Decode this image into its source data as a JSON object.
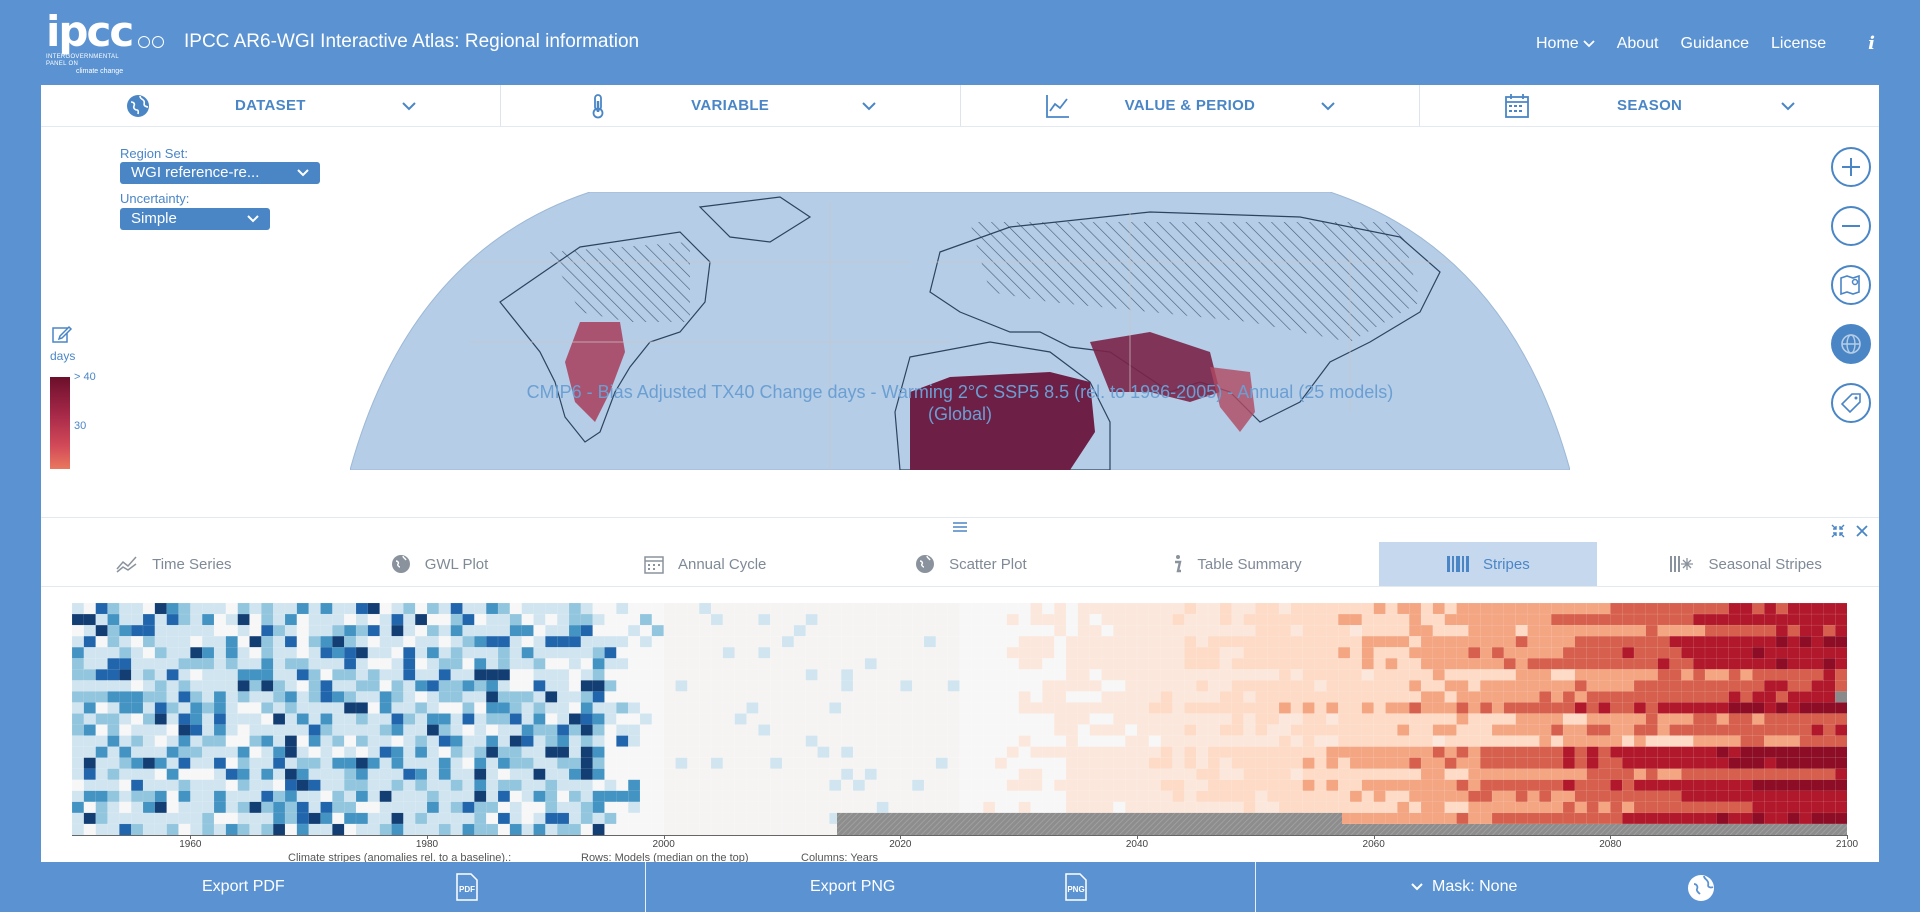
{
  "header": {
    "logo_text": "ipcc",
    "logo_subtitle": "INTERGOVERNMENTAL PANEL ON",
    "logo_subtitle2": "climate change",
    "title": "IPCC AR6-WGI Interactive Atlas: Regional information",
    "nav": {
      "home": "Home",
      "about": "About",
      "guidance": "Guidance",
      "license": "License",
      "info": "i"
    }
  },
  "selectors": {
    "dataset": "DATASET",
    "variable": "VARIABLE",
    "value_period": "VALUE & PERIOD",
    "season": "SEASON"
  },
  "map_controls": {
    "region_set_label": "Region Set:",
    "region_set_value": "WGI reference-re...",
    "uncertainty_label": "Uncertainty:",
    "uncertainty_value": "Simple"
  },
  "legend": {
    "unit": "days",
    "tick_top": "> 40",
    "tick_mid": "30"
  },
  "map_title": {
    "line1": "CMIP6 - Bias Adjusted TX40 Change days - Warming 2°C SSP5 8.5 (rel. to 1986-2005) - Annual (25 models)",
    "line2": "(Global)"
  },
  "tabs": [
    {
      "label": "Time Series"
    },
    {
      "label": "GWL Plot"
    },
    {
      "label": "Annual Cycle"
    },
    {
      "label": "Scatter Plot"
    },
    {
      "label": "Table Summary"
    },
    {
      "label": "Stripes"
    },
    {
      "label": "Seasonal Stripes"
    }
  ],
  "stripes": {
    "x_ticks": [
      "1960",
      "1980",
      "2000",
      "2020",
      "2040",
      "2060",
      "2080",
      "2100"
    ],
    "caption1": "Climate stripes (anomalies rel. to a baseline).:",
    "caption2": "Rows: Models (median on the top)",
    "caption3": "Columns: Years"
  },
  "bottom_bar": {
    "export_pdf": "Export PDF",
    "pdf_icon": "PDF",
    "export_png": "Export PNG",
    "png_icon": "PNG",
    "mask": "Mask: None"
  },
  "colors": {
    "brand": "#5b93d2",
    "accent": "#4a86c6",
    "active_tab": "#c5d8ee"
  }
}
